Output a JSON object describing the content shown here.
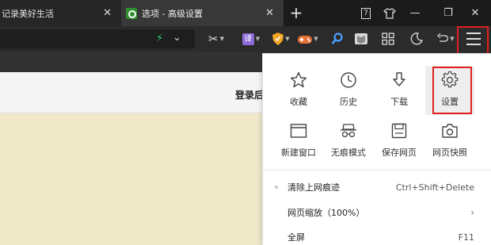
{
  "tabs": [
    {
      "label": "记录美好生活",
      "close": "✕"
    },
    {
      "label": "选项 - 高级设置",
      "close": "✕"
    }
  ],
  "window": {
    "new_tab": "+",
    "counter": "7",
    "minimize": "—",
    "restore": "❐",
    "close": "✕"
  },
  "toolbar": {
    "translate_label": "译"
  },
  "page": {
    "login_text": "登录后"
  },
  "menu": {
    "grid": [
      {
        "label": "收藏",
        "icon": "star-icon"
      },
      {
        "label": "历史",
        "icon": "clock-icon"
      },
      {
        "label": "下载",
        "icon": "download-icon"
      },
      {
        "label": "设置",
        "icon": "gear-icon"
      },
      {
        "label": "新建窗口",
        "icon": "window-icon"
      },
      {
        "label": "无痕模式",
        "icon": "incognito-icon"
      },
      {
        "label": "保存网页",
        "icon": "save-icon"
      },
      {
        "label": "网页快照",
        "icon": "camera-icon"
      }
    ],
    "rows": [
      {
        "label": "清除上网痕迹",
        "shortcut": "Ctrl+Shift+Delete"
      },
      {
        "label": "网页缩放（100%）",
        "arrow": "›"
      },
      {
        "label": "全屏",
        "shortcut": "F11"
      }
    ]
  },
  "colors": {
    "highlight": "#e02020",
    "tab_bg": "#1b1b1b",
    "toolbar_bg": "#2b2b2b",
    "page_bg": "#efe9c9"
  }
}
